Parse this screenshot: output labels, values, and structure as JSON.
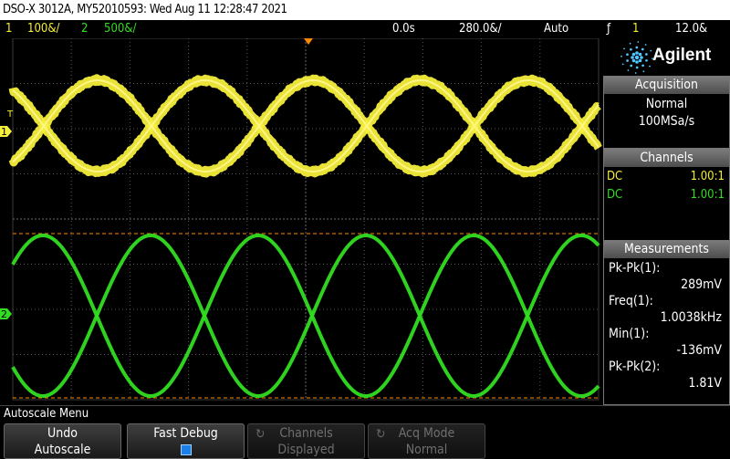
{
  "title": "DSO-X 3012A, MY52010593: Wed Aug 11 12:28:47 2021",
  "status": {
    "ch1_num": "1",
    "ch1_scale": "100&/",
    "ch2_num": "2",
    "ch2_scale": "500&/",
    "time_delay": "0.0s",
    "time_scale": "280.0&/",
    "trigger_mode": "Auto",
    "trigger_slope": "ƒ",
    "trigger_source": "1",
    "trigger_level": "12.0&"
  },
  "screen": {
    "ch1_marker": "1",
    "ch2_marker": "2",
    "trig_marker": "T"
  },
  "panel": {
    "brand": "Agilent",
    "acquisition": {
      "header": "Acquisition",
      "mode": "Normal",
      "rate": "100MSa/s"
    },
    "channels": {
      "header": "Channels",
      "rows": [
        {
          "coupling": "DC",
          "probe": "1.00:1"
        },
        {
          "coupling": "DC",
          "probe": "1.00:1"
        }
      ]
    },
    "measurements": {
      "header": "Measurements",
      "items": [
        {
          "label": "Pk-Pk(1):",
          "value": "289mV"
        },
        {
          "label": "Freq(1):",
          "value": "1.0038kHz"
        },
        {
          "label": "Min(1):",
          "value": "-136mV"
        },
        {
          "label": "Pk-Pk(2):",
          "value": "1.81V"
        }
      ]
    }
  },
  "menu": {
    "title": "Autoscale Menu",
    "softkeys": [
      {
        "line1": "Undo",
        "line2": "Autoscale"
      },
      {
        "line1": "Fast Debug",
        "line2": ""
      },
      {
        "line1": "Channels",
        "line2": "Displayed"
      },
      {
        "line1": "Acq Mode",
        "line2": "Normal"
      }
    ]
  },
  "colors": {
    "ch1": "#f5ee3a",
    "ch2": "#33dd22",
    "grid": "#555555",
    "marker": "#ff8800"
  }
}
